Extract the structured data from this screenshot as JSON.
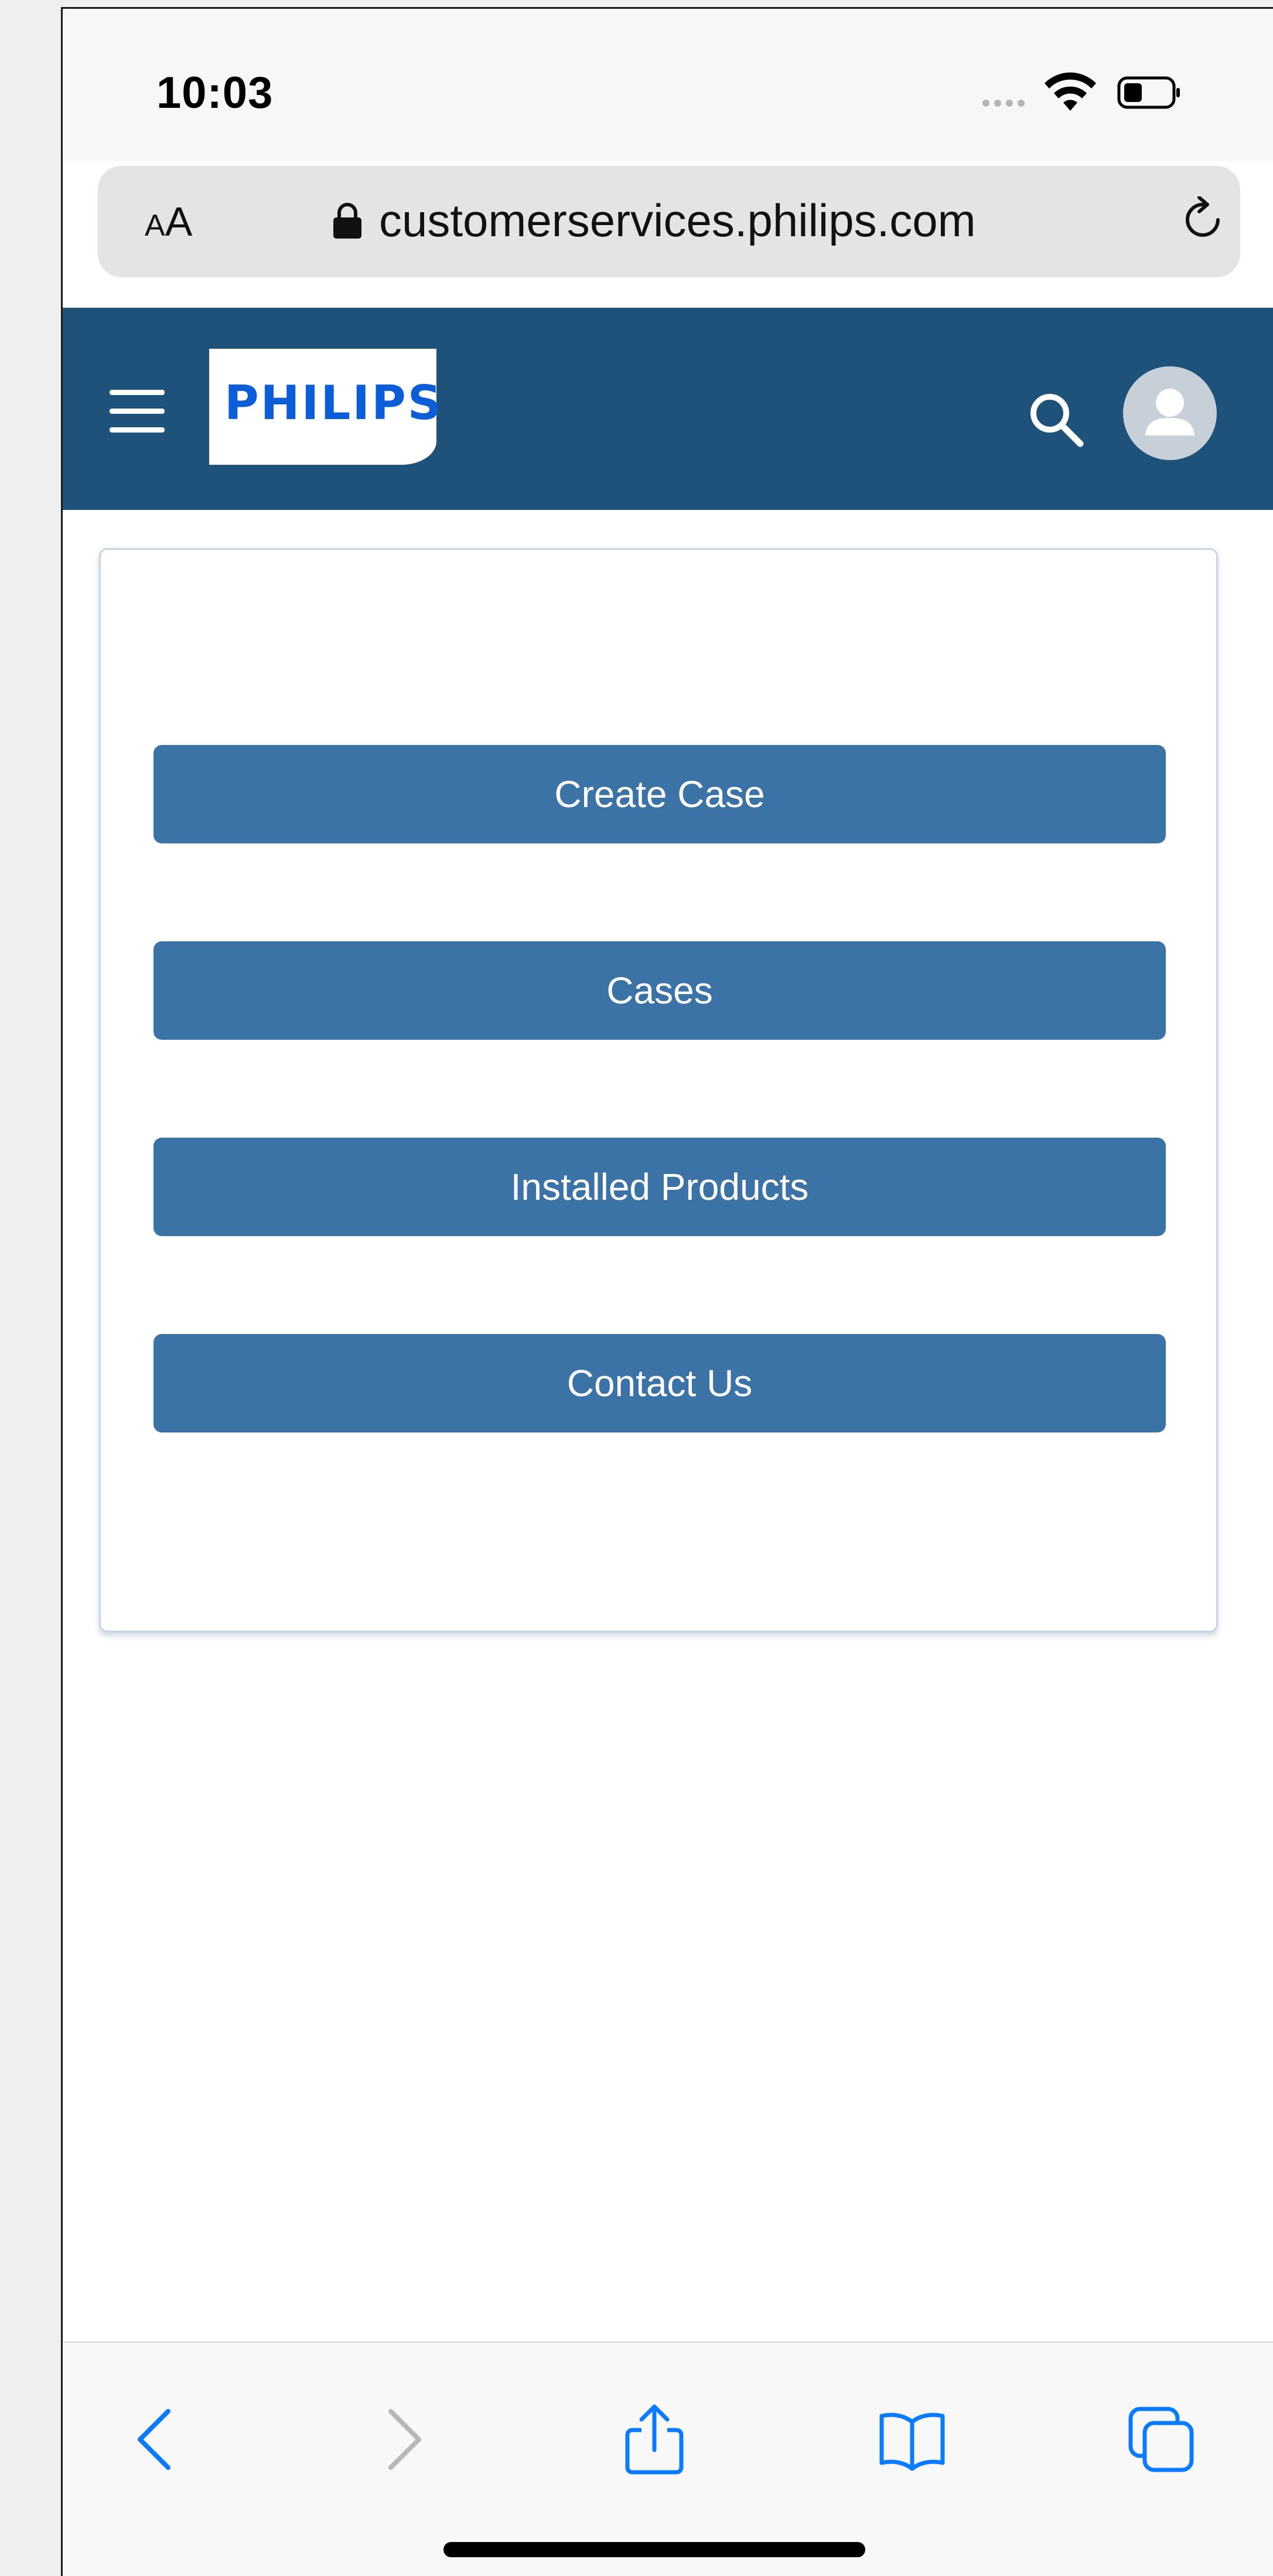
{
  "status_bar": {
    "time": "10:03"
  },
  "url_bar": {
    "text_size_label_small": "A",
    "text_size_label_large": "A",
    "url": "customerservices.philips.com"
  },
  "header": {
    "logo_text": "PHILIPS",
    "background_color": "#1e527a"
  },
  "menu": {
    "buttons": [
      {
        "label": "Create Case"
      },
      {
        "label": "Cases"
      },
      {
        "label": "Installed Products"
      },
      {
        "label": "Contact Us"
      }
    ],
    "button_color": "#3c73a6"
  },
  "toolbar": {
    "icons": [
      "back-icon",
      "forward-icon",
      "share-icon",
      "bookmarks-icon",
      "tabs-icon"
    ],
    "accent_color": "#0a7aff"
  }
}
